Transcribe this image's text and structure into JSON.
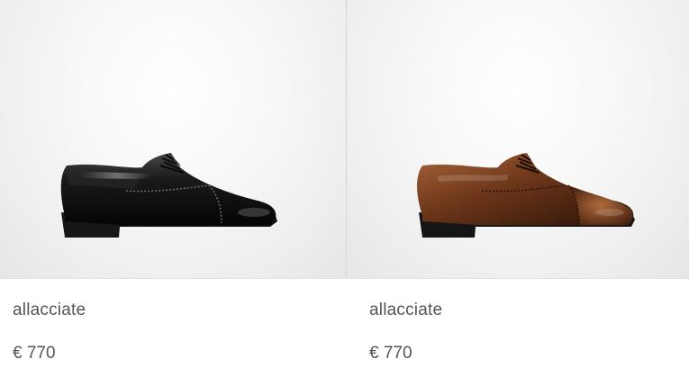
{
  "products": [
    {
      "name": "allacciate",
      "price": "€ 770",
      "image_icon": "black-brogue-oxford-shoe-icon",
      "colors": {
        "upper_dark": "#050505",
        "upper_mid": "#1a1a1a",
        "upper_light": "#4a4a4a",
        "sole": "#111111"
      }
    },
    {
      "name": "allacciate",
      "price": "€ 770",
      "image_icon": "brown-brogue-oxford-shoe-icon",
      "colors": {
        "upper_dark": "#2a1307",
        "upper_mid": "#6b3519",
        "upper_light": "#a8643a",
        "sole": "#151515"
      }
    }
  ]
}
